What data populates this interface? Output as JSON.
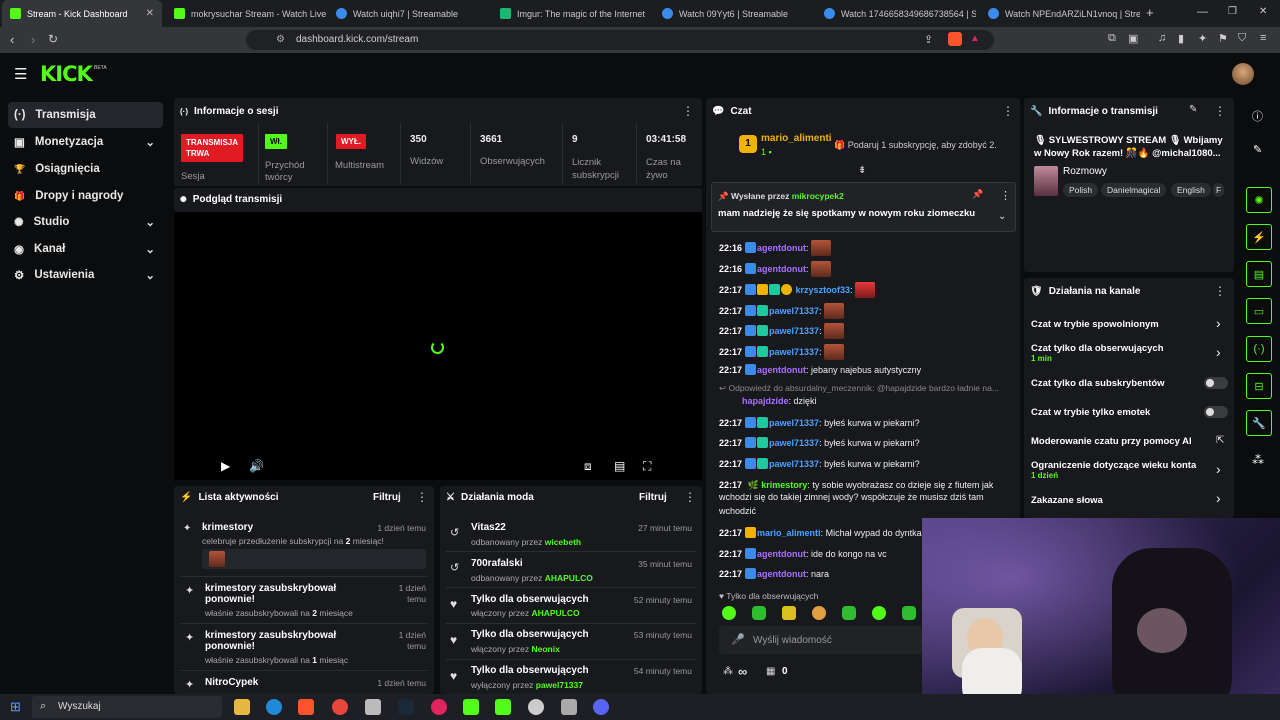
{
  "browser": {
    "tabs": [
      {
        "title": "Stream - Kick Dashboard",
        "fav": "#53fc18"
      },
      {
        "title": "mokrysuchar Stream - Watch Live on",
        "fav": "#53fc18"
      },
      {
        "title": "Watch uiqhi7 | Streamable",
        "fav": "#3b8beb"
      },
      {
        "title": "Imgur: The magic of the Internet",
        "fav": "#1bb76e"
      },
      {
        "title": "Watch 09Yyt6 | Streamable",
        "fav": "#3b8beb"
      },
      {
        "title": "Watch 1746658349686738564 | Stre",
        "fav": "#3b8beb"
      },
      {
        "title": "Watch NPEndARZiLN1vnoq | Stream",
        "fav": "#3b8beb"
      }
    ],
    "new_tab": "+",
    "url": "dashboard.kick.com/stream"
  },
  "header": {
    "logo": "KICK",
    "beta": "BETA"
  },
  "sidebar": {
    "items": [
      {
        "label": "Transmisja",
        "icon": "(·)"
      },
      {
        "label": "Monetyzacja",
        "icon": "▣"
      },
      {
        "label": "Osiągnięcia",
        "icon": "🏆"
      },
      {
        "label": "Dropy i nagrody",
        "icon": "🎁"
      },
      {
        "label": "Studio",
        "icon": "✺"
      },
      {
        "label": "Kanał",
        "icon": "◉"
      },
      {
        "label": "Ustawienia",
        "icon": "⚙"
      }
    ]
  },
  "session": {
    "title": "Informacje o sesji",
    "live_badge": "TRANSMISJA\nTRWA",
    "live_label": "Sesja",
    "revenue_badge": "Wł.",
    "revenue_label": "Przychód twórcy",
    "multistream_badge": "WYŁ.",
    "multistream_label": "Multistream",
    "viewers_value": "350",
    "viewers_label": "Widzów",
    "followers_value": "3661",
    "followers_label": "Obserwujących",
    "subs_value": "9",
    "subs_label": "Licznik subskrypcji",
    "time_value": "03:41:58",
    "time_label": "Czas na żywo"
  },
  "preview": {
    "title": "Podgląd transmisji"
  },
  "activity": {
    "title": "Lista aktywności",
    "filter": "Filtruj",
    "items": [
      {
        "name": "krimestory",
        "sub_pre": "celebruje przedłużenie subskrypcji na ",
        "sub_num": "2",
        "sub_post": " miesiąc!",
        "time": "1 dzień temu"
      },
      {
        "name": "krimestory zasubskrybował ponownie!",
        "sub_pre": "właśnie zasubskrybowali na ",
        "sub_num": "2",
        "sub_post": " miesiące",
        "time": "1 dzień temu"
      },
      {
        "name": "krimestory zasubskrybował ponownie!",
        "sub_pre": "właśnie zasubskrybowali na ",
        "sub_num": "1",
        "sub_post": " miesiąc",
        "time": "1 dzień temu"
      },
      {
        "name": "NitroCypek",
        "sub_pre": "",
        "sub_num": "",
        "sub_post": "",
        "time": "1 dzień temu"
      }
    ]
  },
  "modactions": {
    "title": "Działania moda",
    "filter": "Filtruj",
    "items": [
      {
        "name": "Vitas22",
        "by_pre": "odbanowany przez ",
        "by": "wicebeth",
        "time": "27 minut temu"
      },
      {
        "name": "700rafalski",
        "by_pre": "odbanowany przez ",
        "by": "AHAPULCO",
        "time": "35 minut temu"
      },
      {
        "name": "Tylko dla obserwujących",
        "by_pre": "włączony przez ",
        "by": "AHAPULCO",
        "time": "52 minuty temu"
      },
      {
        "name": "Tylko dla obserwujących",
        "by_pre": "włączony przez ",
        "by": "Neonix",
        "time": "53 minuty temu"
      },
      {
        "name": "Tylko dla obserwujących",
        "by_pre": "wyłączony przez ",
        "by": "pawel71337",
        "time": "54 minuty temu"
      }
    ]
  },
  "chat": {
    "title": "Czat",
    "top_user": "mario_alimenti",
    "top_count": "1",
    "top_gift": "Podaruj 1 subskrypcję, aby zdobyć 2.",
    "pinned_label": "Wysłane przez",
    "pinned_user": "mikrocypek2",
    "pinned_text": "mam nadzieję że się spotkamy w nowym roku ziomeczku",
    "messages": [
      {
        "t": "22:16",
        "u": "agentdonut",
        "c": "u-purple",
        "m": ""
      },
      {
        "t": "22:16",
        "u": "agentdonut",
        "c": "u-purple",
        "m": ""
      },
      {
        "t": "22:17",
        "u": "krzysztoof33",
        "c": "u-blue",
        "m": ""
      },
      {
        "t": "22:17",
        "u": "pawel71337",
        "c": "u-blue",
        "m": ""
      },
      {
        "t": "22:17",
        "u": "pawel71337",
        "c": "u-blue",
        "m": ""
      },
      {
        "t": "22:17",
        "u": "pawel71337",
        "c": "u-blue",
        "m": ""
      },
      {
        "t": "22:17",
        "u": "agentdonut",
        "c": "u-purple",
        "m": "jebany najebus autystyczny"
      }
    ],
    "reply_note": "Odpowiedź do absurdalny_meczennik: @hapajdzide bardzo ładnie na...",
    "reply_user": "hapajdzide",
    "reply_msg": "dzięki",
    "messages2": [
      {
        "t": "22:17",
        "u": "pawel71337",
        "m": "byłeś kurwa w piekarni?"
      },
      {
        "t": "22:17",
        "u": "pawel71337",
        "m": "byłeś kurwa w piekarni?"
      },
      {
        "t": "22:17",
        "u": "pawel71337",
        "m": "byłeś kurwa w piekarni?"
      }
    ],
    "krime_time": "22:17",
    "krime_user": "krimestory",
    "krime_msg1": "ty sobie wyobrażasz co dzieje się z fiutem jak",
    "krime_msg2": "wchodzi się do takiej zimnej wody? współczuje że musisz dziś tam",
    "krime_msg3": "wchodzić",
    "messages3": [
      {
        "t": "22:17",
        "u": "mario_alimenti",
        "c": "u-blue",
        "m": "Michał wypad do dyntka"
      },
      {
        "t": "22:17",
        "u": "agentdonut",
        "c": "u-purple",
        "m": "ide do kongo na vc"
      },
      {
        "t": "22:17",
        "u": "agentdonut",
        "c": "u-purple",
        "m": "nara"
      }
    ],
    "followers_only": "Tylko dla obserwujących",
    "input_placeholder": "Wyślij wiadomość",
    "points": "∞",
    "gifts": "0"
  },
  "stream_info": {
    "title": "Informacje o transmisji",
    "stream_title": "🎙 SYLWESTROWY STREAM 🎙 Wbijamy w Nowy Rok razem! 🎊🔥 @michal1080...",
    "category": "Rozmowy",
    "tags": [
      "Polish",
      "Danielmagical",
      "English",
      "F"
    ]
  },
  "channel_actions": {
    "title": "Działania na kanale",
    "items": [
      {
        "label": "Czat w trybie spowolnionym",
        "sub": "",
        "ctrl": "chevron"
      },
      {
        "label": "Czat tylko dla obserwujących",
        "sub": "1 min",
        "ctrl": "chevron"
      },
      {
        "label": "Czat tylko dla subskrybentów",
        "sub": "",
        "ctrl": "toggle"
      },
      {
        "label": "Czat w trybie tylko emotek",
        "sub": "",
        "ctrl": "toggle"
      },
      {
        "label": "Moderowanie czatu przy pomocy AI",
        "sub": "",
        "ctrl": "external"
      },
      {
        "label": "Ograniczenie dotyczące wieku konta",
        "sub": "1 dzień",
        "ctrl": "chevron"
      },
      {
        "label": "Zakazane słowa",
        "sub": "",
        "ctrl": "chevron"
      }
    ]
  },
  "taskbar": {
    "search": "Wyszukaj"
  },
  "colors": {
    "accent": "#53fc18",
    "live": "#e01b24",
    "panel": "#18191c"
  }
}
